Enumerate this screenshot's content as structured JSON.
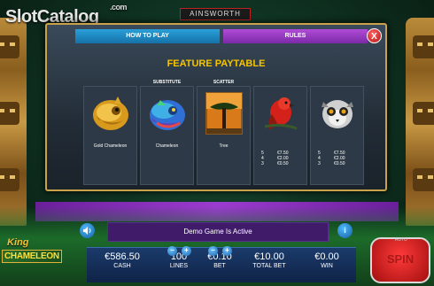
{
  "branding": {
    "site_logo": "SlotCatalog",
    "site_logo_suffix": ".com",
    "provider": "AINSWORTH",
    "game_name_line1": "King",
    "game_name_line2": "CHAMELEON"
  },
  "tabs": [
    {
      "label": "HOW TO PLAY"
    },
    {
      "label": "RULES"
    }
  ],
  "paytable": {
    "title": "FEATURE PAYTABLE",
    "close_label": "X",
    "symbols": [
      {
        "top_label": "",
        "name": "Gold Chameleon",
        "pays": []
      },
      {
        "top_label": "SUBSTITUTE",
        "name": "Chameleon",
        "pays": []
      },
      {
        "top_label": "SCATTER",
        "name": "Tree",
        "pays": []
      },
      {
        "top_label": "",
        "name": "",
        "pays": [
          {
            "count": "5",
            "amount": "€7.50"
          },
          {
            "count": "4",
            "amount": "€2.00"
          },
          {
            "count": "3",
            "amount": "€0.50"
          }
        ]
      },
      {
        "top_label": "",
        "name": "",
        "pays": [
          {
            "count": "5",
            "amount": "€7.50"
          },
          {
            "count": "4",
            "amount": "€2.00"
          },
          {
            "count": "3",
            "amount": "€0.50"
          }
        ]
      }
    ]
  },
  "status": {
    "message": "Demo Game Is Active",
    "info_label": "i",
    "sound_label": "🔊"
  },
  "stats": {
    "cash": {
      "value": "€586.50",
      "label": "CASH"
    },
    "lines": {
      "value": "100",
      "label": "LINES"
    },
    "bet": {
      "value": "€0.10",
      "label": "BET"
    },
    "total_bet": {
      "value": "€10.00",
      "label": "TOTAL BET"
    },
    "win": {
      "value": "€0.00",
      "label": "WIN"
    }
  },
  "spin": {
    "label": "SPIN",
    "auto_label": "AUTO"
  },
  "icons": {
    "sound": "speaker-icon",
    "info": "info-icon",
    "close": "close-icon",
    "minus": "minus-icon",
    "plus": "plus-icon"
  },
  "colors": {
    "title_gold": "#f6c400",
    "tab_blue": "#1572a8",
    "tab_purple": "#7a2aa6",
    "spin_red": "#d11"
  }
}
